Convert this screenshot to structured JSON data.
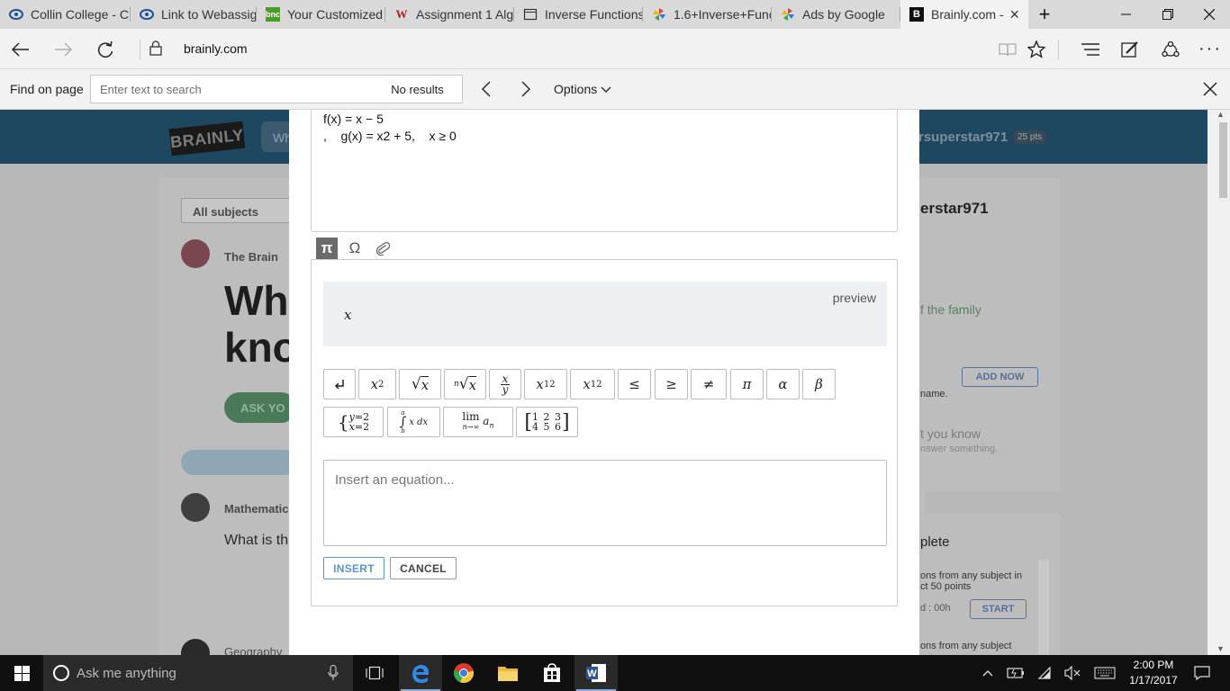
{
  "tabs": [
    {
      "title": "Collin College - C",
      "icon": "collin-icon"
    },
    {
      "title": "Link to Webassign",
      "icon": "collin-icon"
    },
    {
      "title": "Your Customized",
      "icon": "bnc-icon",
      "icon_text": "bnc"
    },
    {
      "title": "Assignment 1 Alg",
      "icon": "webassign-icon",
      "icon_text": "W"
    },
    {
      "title": "Inverse Functions",
      "icon": "page-icon"
    },
    {
      "title": "1.6+Inverse+Func",
      "icon": "pinwheel-icon"
    },
    {
      "title": "Ads by Google",
      "icon": "google-icon"
    },
    {
      "title": "Brainly.com -",
      "icon": "brainly-icon",
      "icon_text": "B",
      "active": true
    }
  ],
  "address": {
    "url": "brainly.com"
  },
  "find": {
    "label": "Find on page",
    "placeholder": "Enter text to search",
    "results": "No results",
    "options": "Options"
  },
  "background": {
    "username": "rsuperstar971",
    "points": "25 pts",
    "subjects": "All subjects",
    "author": "The Brain",
    "question_title": [
      "Wh",
      "kno"
    ],
    "ask_button": "ASK YO",
    "subject_label": "Mathematic",
    "question_snippet": "What is th",
    "geo_label": "Geography",
    "right_name": "erstar971",
    "family_text": "f the family",
    "add_now": "ADD NOW",
    "name_label": "name.",
    "you_know": "t you know",
    "answer_something": "nswer something.",
    "complete": "plete",
    "challenge_text_1": "ons from any subject in",
    "challenge_text_2": "ct 50 points",
    "timer": "d : 00h",
    "start": "START",
    "challenge_text_3": "ons from any subject"
  },
  "modal": {
    "question_line_1": "f(x) = x − 5",
    "question_line_2": ",    g(x) = x2 + 5,    x ≥ 0",
    "tools": [
      "π",
      "Ω",
      "paperclip"
    ],
    "preview_label": "preview",
    "preview_value": "x",
    "equation_placeholder": "Insert an equation...",
    "insert_label": "INSERT",
    "cancel_label": "CANCEL"
  },
  "taskbar": {
    "search_placeholder": "Ask me anything",
    "time": "2:00 PM",
    "date": "1/17/2017"
  },
  "colors": {
    "brainly_header": "#1e4860",
    "insert_accent": "#5a96c8",
    "taskbar": "#101010"
  }
}
